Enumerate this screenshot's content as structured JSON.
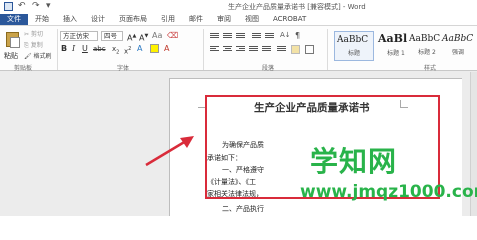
{
  "window": {
    "title": "生产企业产品质量承诺书 [兼容模式] - Word"
  },
  "ribbon_tabs": [
    {
      "label": "文件"
    },
    {
      "label": "开始"
    },
    {
      "label": "插入"
    },
    {
      "label": "设计"
    },
    {
      "label": "页面布局"
    },
    {
      "label": "引用"
    },
    {
      "label": "邮件"
    },
    {
      "label": "审阅"
    },
    {
      "label": "视图"
    },
    {
      "label": "ACROBAT"
    }
  ],
  "clipboard": {
    "paste_label": "粘贴",
    "cut_label": "剪切",
    "copy_label": "复制",
    "format_painter_label": "格式刷",
    "group_label": "剪贴板"
  },
  "font": {
    "font_name": "方正仿宋",
    "font_size": "四号",
    "bold": "B",
    "italic": "I",
    "underline": "U",
    "font_color_glyph": "A",
    "group_label": "字体"
  },
  "paragraph": {
    "group_label": "段落"
  },
  "styles": {
    "items": [
      {
        "sample": "AaBbC",
        "name": "标题"
      },
      {
        "sample": "AaBl",
        "name": "标题 1"
      },
      {
        "sample": "AaBbC",
        "name": "标题 2"
      },
      {
        "sample": "AaBbC",
        "name": "强调"
      }
    ],
    "group_label": "样式"
  },
  "document": {
    "title": "生产企业产品质量承诺书",
    "lines": [
      "为确保产品质",
      "承诺如下：",
      "一、严格遵守",
      "《计量法》、《工",
      "家相关法律法规，",
      "二、产品执行"
    ]
  },
  "watermark": {
    "text": "学知网",
    "url": "www.jmqz1000.com"
  },
  "colors": {
    "accent": "#2b579a",
    "highlight_border": "#d92b3a",
    "watermark": "#29b34a"
  }
}
